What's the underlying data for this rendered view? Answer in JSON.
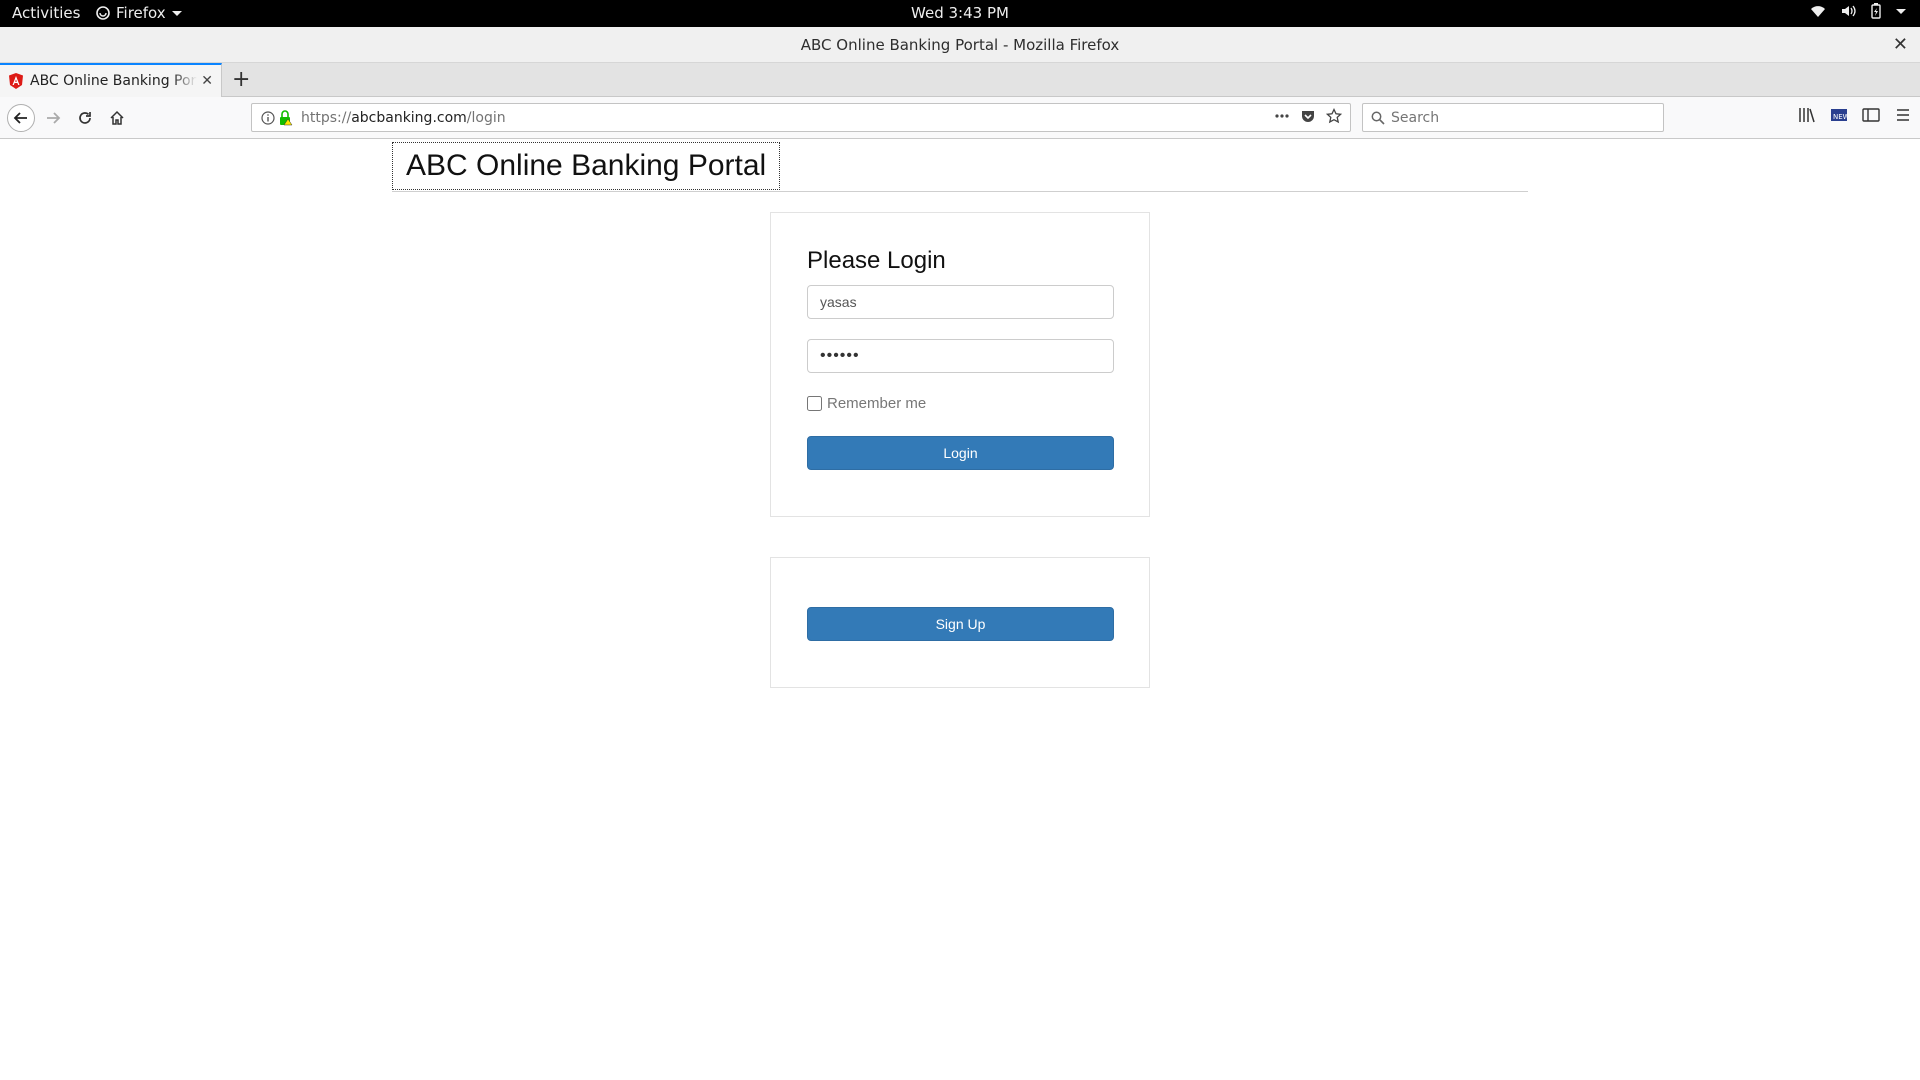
{
  "system_bar": {
    "activities": "Activities",
    "app_name": "Firefox",
    "clock": "Wed  3:43 PM"
  },
  "window": {
    "title": "ABC Online Banking Portal - Mozilla Firefox"
  },
  "tab": {
    "title": "ABC Online Banking Portal"
  },
  "navbar": {
    "url_scheme": "https://",
    "url_host": "abcbanking.com",
    "url_path": "/login",
    "search_placeholder": "Search"
  },
  "page": {
    "brand": "ABC Online Banking Portal",
    "login": {
      "heading": "Please Login",
      "username_value": "yasas",
      "password_value": "••••••",
      "remember_label": "Remember me",
      "remember_checked": false,
      "login_button": "Login"
    },
    "signup": {
      "signup_button": "Sign Up"
    }
  },
  "colors": {
    "primary_button": "#337ab7",
    "tab_accent": "#0a84ff",
    "favicon_red": "#dd1b16"
  },
  "icons": [
    "network-wifi-icon",
    "volume-icon",
    "battery-icon",
    "system-menu-icon",
    "info-icon",
    "secure-lock-icon",
    "page-actions-icon",
    "pocket-icon",
    "bookmark-star-icon",
    "search-icon",
    "library-icon",
    "sidebar-icon",
    "hamburger-menu-icon"
  ]
}
